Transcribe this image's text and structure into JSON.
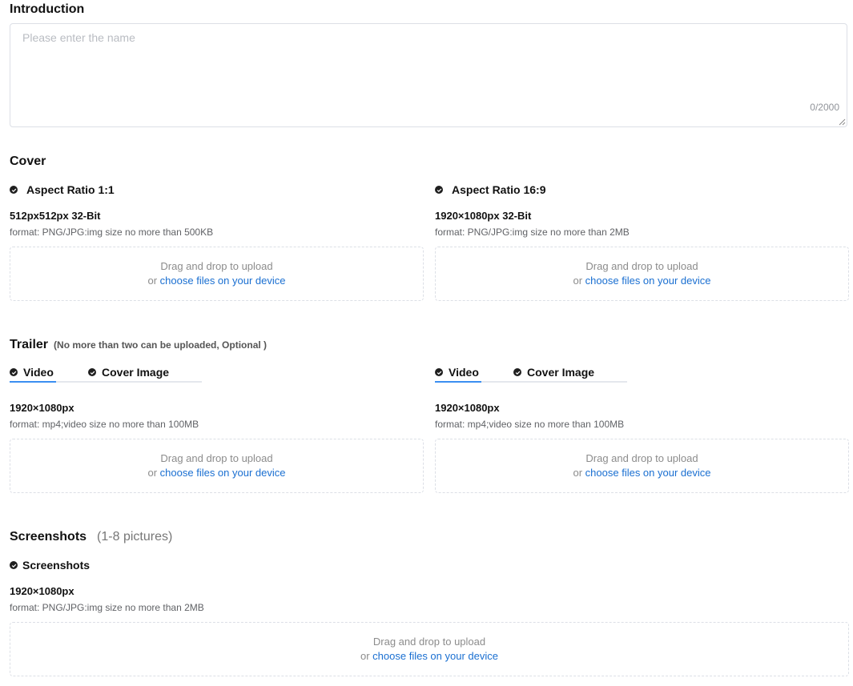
{
  "introduction": {
    "title": "Introduction",
    "placeholder": "Please enter the name",
    "counter": "0/2000"
  },
  "cover": {
    "title": "Cover",
    "left": {
      "heading": "Aspect Ratio 1:1",
      "spec": "512px512px 32-Bit",
      "format": "format: PNG/JPG:img size no more than 500KB"
    },
    "right": {
      "heading": "Aspect Ratio 16:9",
      "spec": "1920×1080px 32-Bit",
      "format": "format: PNG/JPG:img size no more than 2MB"
    }
  },
  "upload": {
    "drag_text": "Drag and drop to upload",
    "or_text": "or ",
    "link_text": "choose files on your device"
  },
  "trailer": {
    "title": "Trailer",
    "note": "(No more than two can be uploaded, Optional )",
    "tab_video": "Video",
    "tab_cover": "Cover Image",
    "spec": "1920×1080px",
    "format": "format: mp4;video size no more than 100MB"
  },
  "screenshots": {
    "title": "Screenshots",
    "note": "(1-8 pictures)",
    "heading": "Screenshots",
    "spec": "1920×1080px",
    "format": "format: PNG/JPG:img size no more than 2MB"
  }
}
